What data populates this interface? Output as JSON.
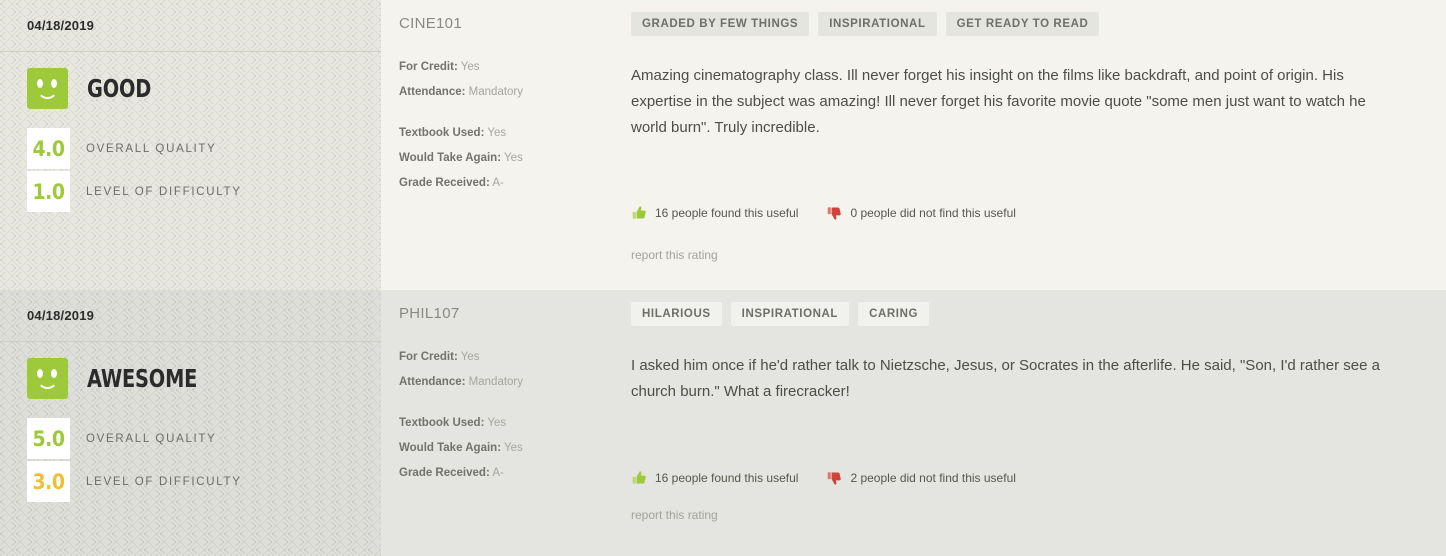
{
  "labels": {
    "overall_quality": "OVERALL QUALITY",
    "level_of_difficulty": "LEVEL OF DIFFICULTY",
    "for_credit_key": "For Credit",
    "attendance_key": "Attendance",
    "textbook_key": "Textbook Used",
    "would_take_again_key": "Would Take Again",
    "grade_key": "Grade Received",
    "report_link": "report this rating"
  },
  "colors": {
    "green": "#9ec93a",
    "amber": "#eec03a",
    "thumb_up": "#9ec93a",
    "thumb_down": "#cf4436",
    "card_light": "#f4f3ee",
    "card_dark": "#e4e4e0"
  },
  "ratings": [
    {
      "date": "04/18/2019",
      "emoji": "smiley-happy-icon",
      "quality_word": "GOOD",
      "overall_quality": "4.0",
      "overall_quality_color": "green",
      "level_of_difficulty": "1.0",
      "level_of_difficulty_color": "green",
      "course": "CINE101",
      "for_credit": "Yes",
      "attendance": "Mandatory",
      "textbook_used": "Yes",
      "would_take_again": "Yes",
      "grade_received": "A-",
      "tags": [
        "GRADED BY FEW THINGS",
        "INSPIRATIONAL",
        "GET READY TO READ"
      ],
      "comment": "Amazing cinematography class. Ill never forget his insight on the films like backdraft, and point of origin. His expertise in the subject was amazing! Ill never forget his favorite movie quote \"some men just want to watch he world burn\". Truly incredible.",
      "useful": "16 people found this useful",
      "not_useful": "0 people did not find this useful"
    },
    {
      "date": "04/18/2019",
      "emoji": "smiley-happy-icon",
      "quality_word": "AWESOME",
      "overall_quality": "5.0",
      "overall_quality_color": "green",
      "level_of_difficulty": "3.0",
      "level_of_difficulty_color": "amber",
      "course": "PHIL107",
      "for_credit": "Yes",
      "attendance": "Mandatory",
      "textbook_used": "Yes",
      "would_take_again": "Yes",
      "grade_received": "A-",
      "tags": [
        "HILARIOUS",
        "INSPIRATIONAL",
        "CARING"
      ],
      "comment": "I asked him once if he'd rather talk to Nietzsche, Jesus, or Socrates in the afterlife. He said, \"Son, I'd rather see a church burn.\" What a firecracker!",
      "useful": "16 people found this useful",
      "not_useful": "2 people did not find this useful"
    }
  ]
}
